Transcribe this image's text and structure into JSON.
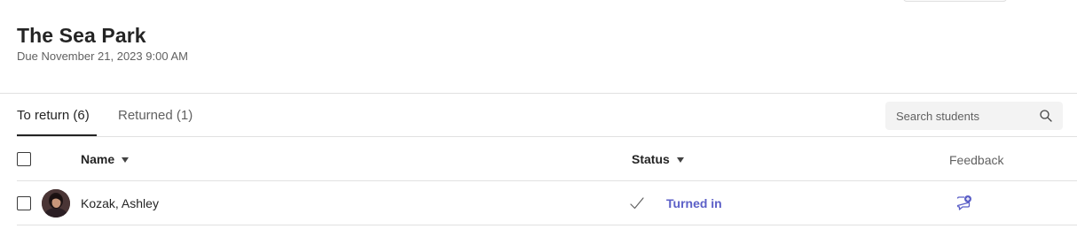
{
  "assignment": {
    "title": "The Sea Park",
    "due": "Due November 21, 2023 9:00 AM"
  },
  "tabs": [
    {
      "label": "To return (6)",
      "active": true
    },
    {
      "label": "Returned (1)",
      "active": false
    }
  ],
  "search": {
    "placeholder": "Search students",
    "icon": "search-icon"
  },
  "table": {
    "columns": {
      "name": "Name",
      "status": "Status",
      "feedback": "Feedback"
    },
    "rows": [
      {
        "name": "Kozak, Ashley",
        "status": "Turned in",
        "status_icon": "checkmark-icon",
        "feedback_icon": "add-feedback-icon"
      }
    ]
  },
  "colors": {
    "accent": "#5b5fc7",
    "text": "#242424",
    "subtle_text": "#616161"
  }
}
